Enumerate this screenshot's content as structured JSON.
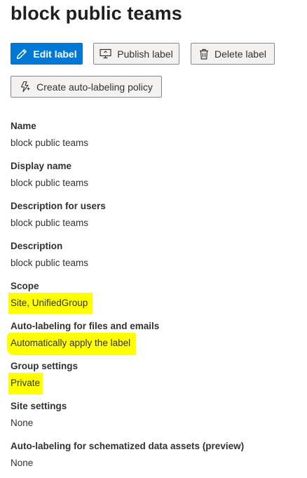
{
  "page_title": "block public teams",
  "toolbar": {
    "edit_label": "Edit label",
    "publish_label": "Publish label",
    "delete_label": "Delete label",
    "auto_policy_label": "Create auto-labeling policy"
  },
  "fields": [
    {
      "label": "Name",
      "value": "block public teams"
    },
    {
      "label": "Display name",
      "value": "block public teams"
    },
    {
      "label": "Description for users",
      "value": "block public teams"
    },
    {
      "label": "Description",
      "value": "block public teams"
    },
    {
      "label": "Scope",
      "value": "Site, UnifiedGroup",
      "highlighted": true
    },
    {
      "label": "Auto-labeling for files and emails",
      "value": "Automatically apply the label",
      "highlighted": true
    },
    {
      "label": "Group settings",
      "value": "Private",
      "highlighted": true
    },
    {
      "label": "Site settings",
      "value": "None"
    },
    {
      "label": "Auto-labeling for schematized data assets (preview)",
      "value": "None"
    }
  ],
  "colors": {
    "primary": "#0078d4",
    "highlight": "#ffff00"
  }
}
